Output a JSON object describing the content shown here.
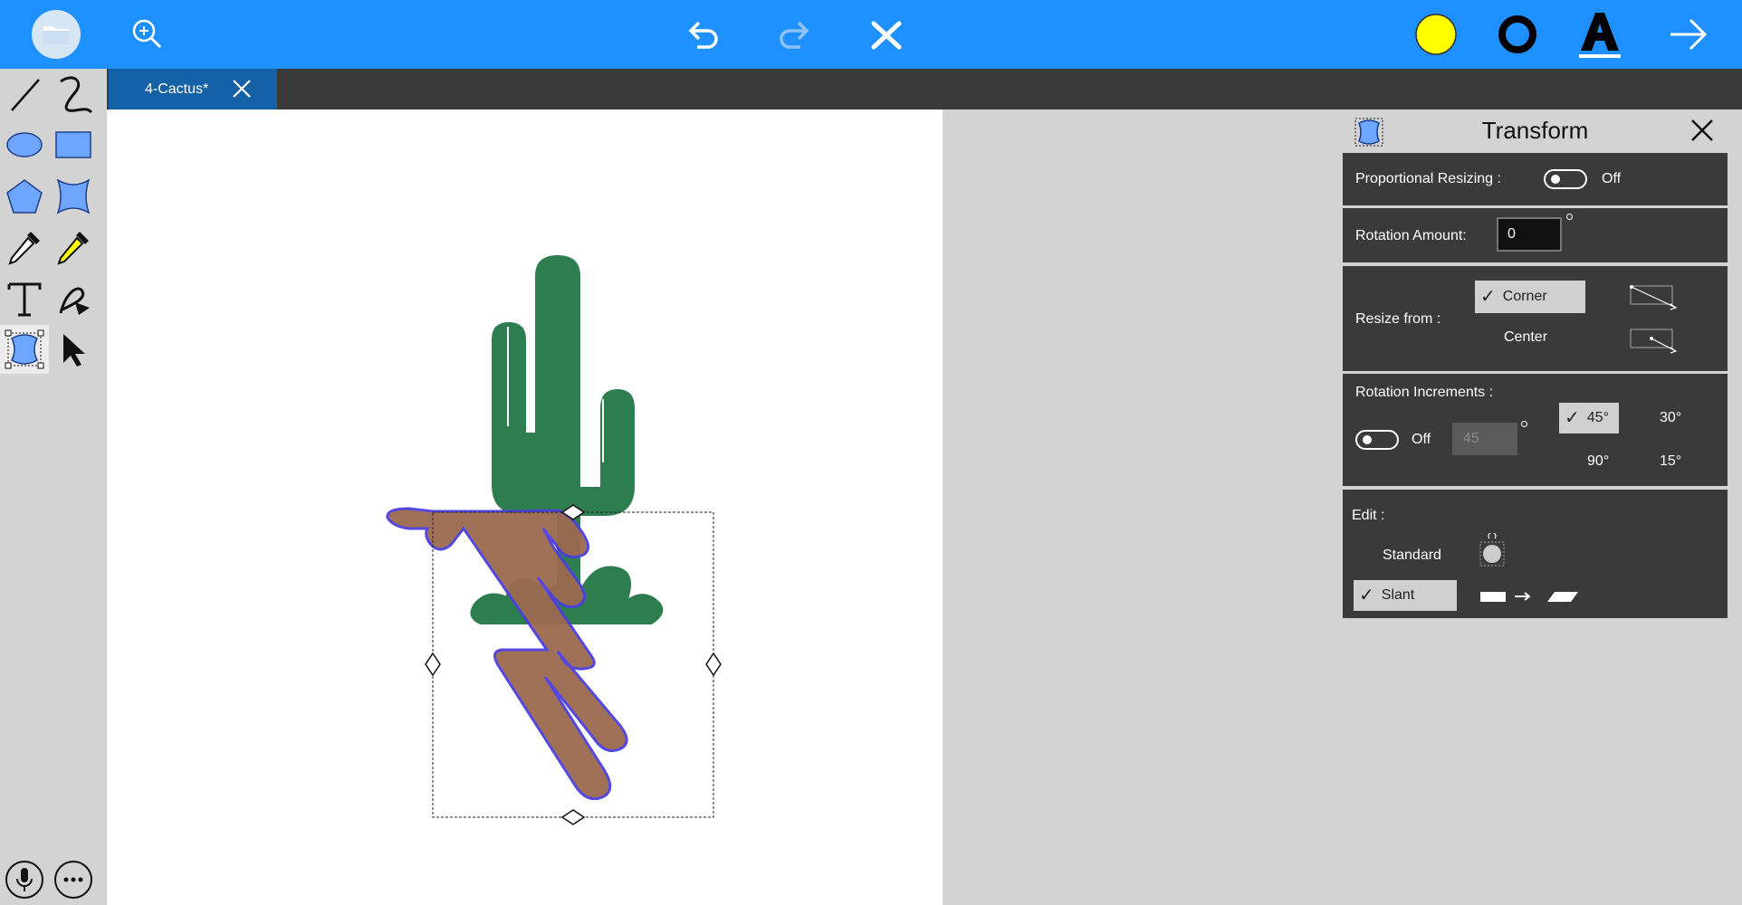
{
  "toolbar": {
    "fill_color": "#ffff00",
    "stroke_color": "#000000",
    "accent": "#1e90ff"
  },
  "tabs": [
    {
      "label": "4-Cactus*"
    }
  ],
  "transform_panel": {
    "title": "Transform",
    "proportional_resizing": {
      "label": "Proportional Resizing :",
      "state": "Off"
    },
    "rotation_amount": {
      "label": "Rotation Amount:",
      "value": "0"
    },
    "resize_from": {
      "label": "Resize from :",
      "options": [
        "Corner",
        "Center"
      ],
      "selected": "Corner"
    },
    "rotation_increments": {
      "label": "Rotation Increments :",
      "state": "Off",
      "custom_value": "45",
      "options": [
        "45°",
        "30°",
        "90°",
        "15°"
      ],
      "selected": "45°"
    },
    "edit": {
      "label": "Edit :",
      "options": [
        "Standard",
        "Slant"
      ],
      "selected": "Slant"
    }
  },
  "colors": {
    "cactus_green": "#2e7d4f",
    "cactus_brown": "#9b6a4e",
    "selection_outline": "#4b3fe0",
    "panel_dark": "#3a3a3a",
    "tab_active": "#1561a8"
  }
}
